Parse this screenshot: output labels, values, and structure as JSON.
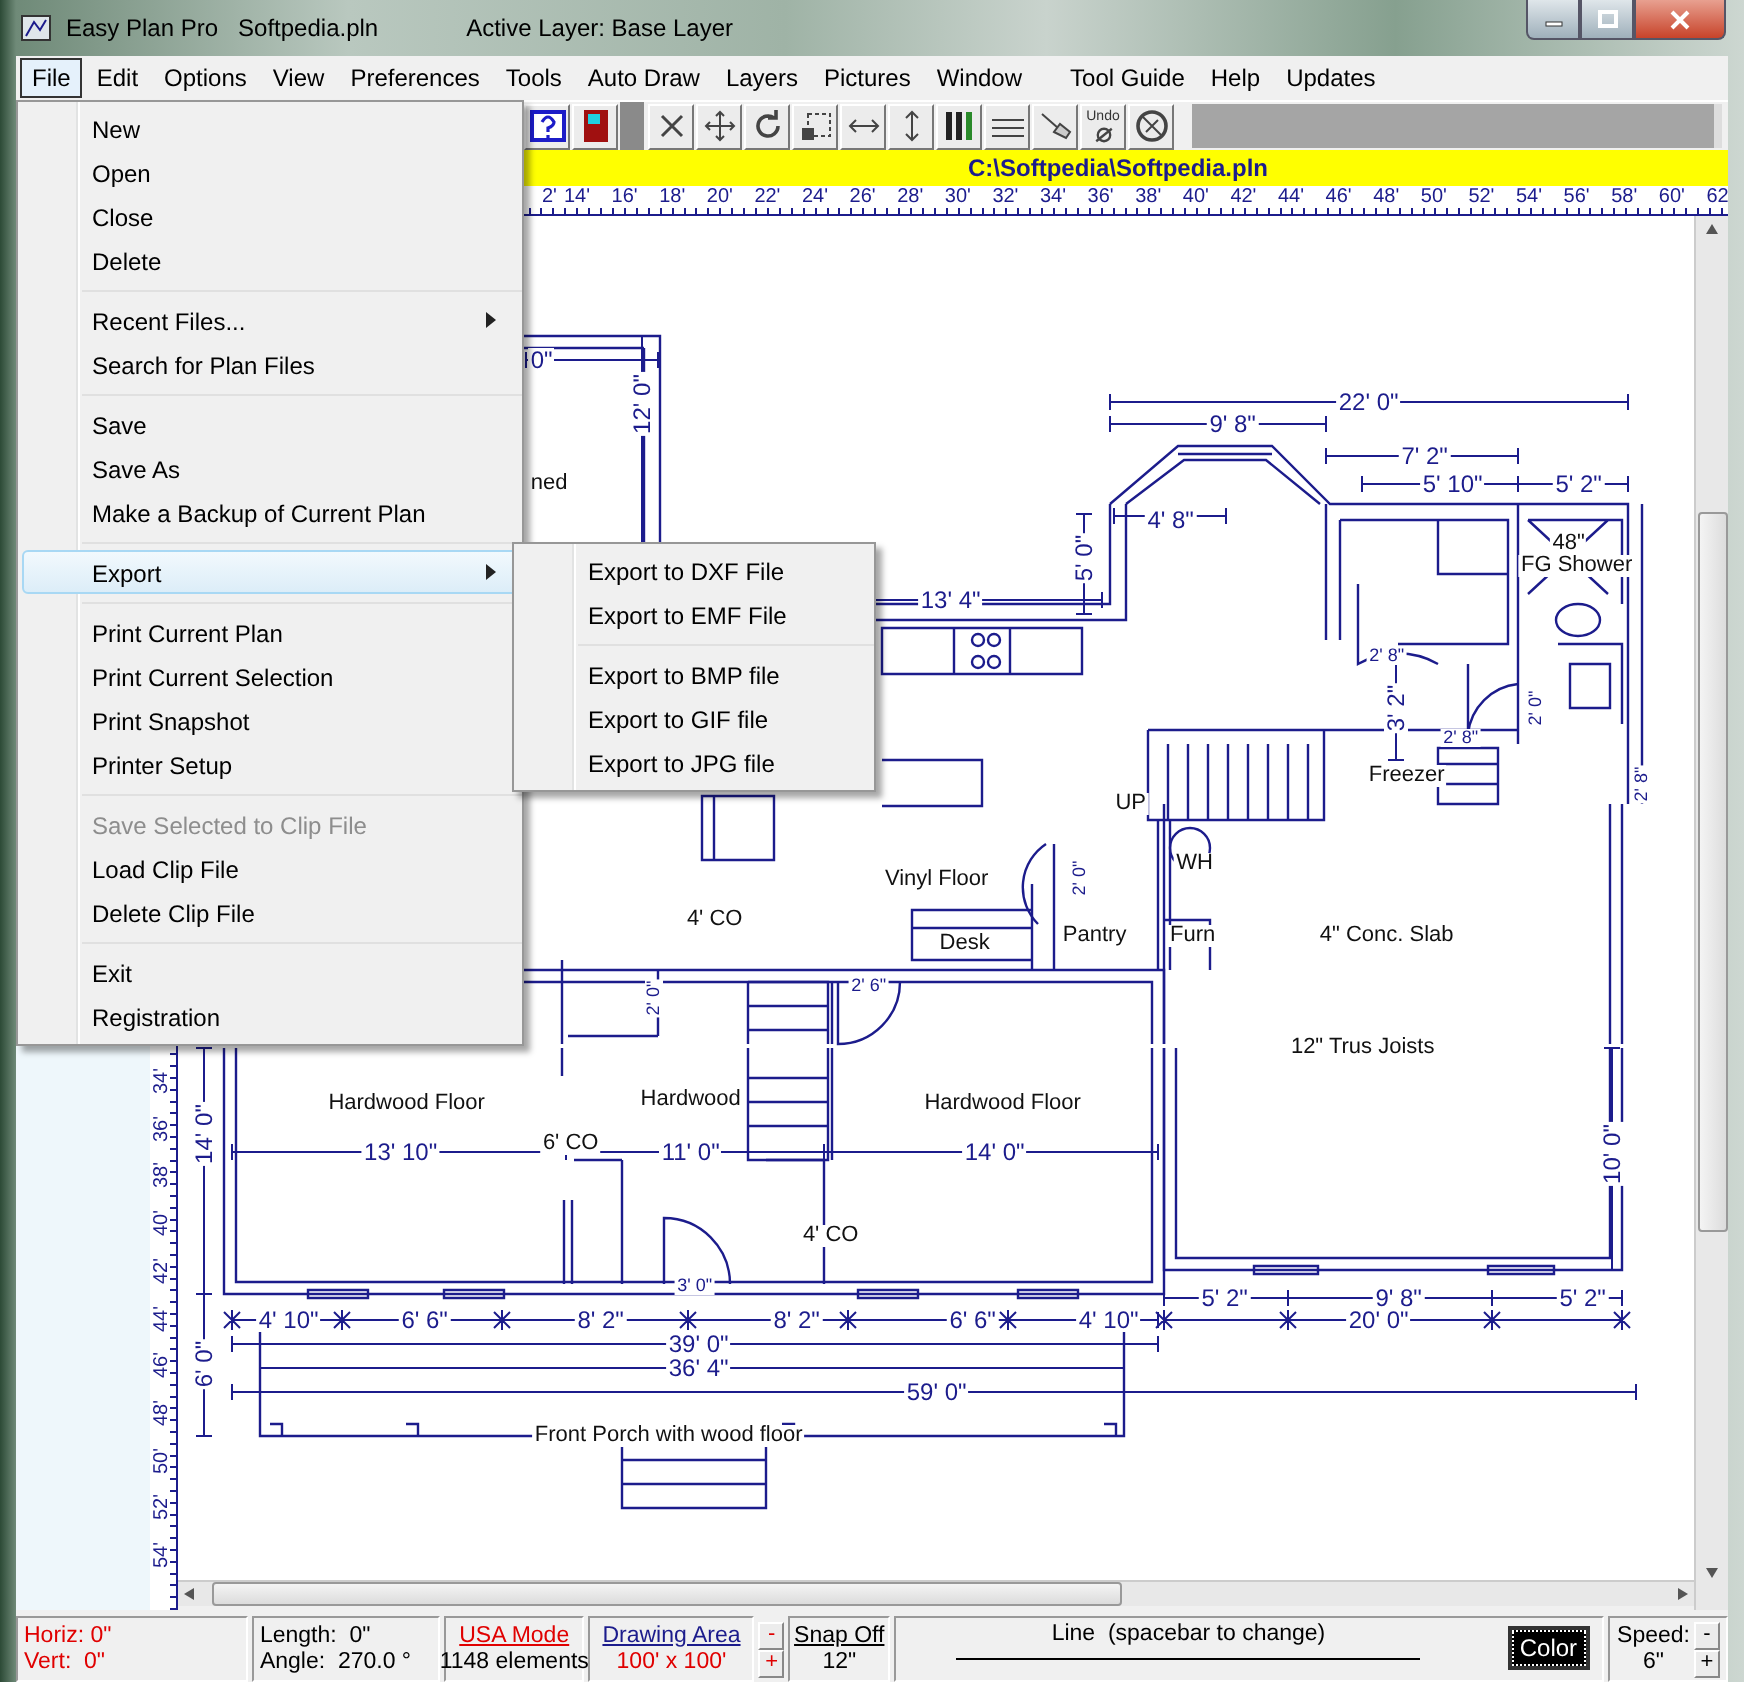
{
  "window": {
    "title": "Easy Plan Pro   Softpedia.pln",
    "active_layer": "Active Layer: Base Layer"
  },
  "menu_bar": [
    {
      "label": "File",
      "selected": true
    },
    {
      "label": "Edit",
      "selected": false
    },
    {
      "label": "Options",
      "selected": false
    },
    {
      "label": "View",
      "selected": false
    },
    {
      "label": "Preferences",
      "selected": false
    },
    {
      "label": "Tools",
      "selected": false
    },
    {
      "label": "Auto Draw",
      "selected": false
    },
    {
      "label": "Layers",
      "selected": false
    },
    {
      "label": "Pictures",
      "selected": false
    },
    {
      "label": "Window",
      "selected": false
    },
    {
      "label": "Tool Guide",
      "selected": false
    },
    {
      "label": "Help",
      "selected": false
    },
    {
      "label": "Updates",
      "selected": false
    }
  ],
  "toolbar": {
    "undo_label": "Undo"
  },
  "file_menu": {
    "groups": [
      [
        {
          "label": "New",
          "selected": false,
          "disabled": false,
          "submenu": false
        },
        {
          "label": "Open",
          "selected": false,
          "disabled": false,
          "submenu": false
        },
        {
          "label": "Close",
          "selected": false,
          "disabled": false,
          "submenu": false
        },
        {
          "label": "Delete",
          "selected": false,
          "disabled": false,
          "submenu": false
        }
      ],
      [
        {
          "label": "Recent Files...",
          "selected": false,
          "disabled": false,
          "submenu": true
        },
        {
          "label": "Search for Plan Files",
          "selected": false,
          "disabled": false,
          "submenu": false
        }
      ],
      [
        {
          "label": "Save",
          "selected": false,
          "disabled": false,
          "submenu": false
        },
        {
          "label": "Save As",
          "selected": false,
          "disabled": false,
          "submenu": false
        },
        {
          "label": "Make a Backup of Current Plan",
          "selected": false,
          "disabled": false,
          "submenu": false
        }
      ],
      [
        {
          "label": "Export",
          "selected": true,
          "disabled": false,
          "submenu": true
        }
      ],
      [
        {
          "label": "Print Current Plan",
          "selected": false,
          "disabled": false,
          "submenu": false
        },
        {
          "label": "Print Current Selection",
          "selected": false,
          "disabled": false,
          "submenu": false
        },
        {
          "label": "Print Snapshot",
          "selected": false,
          "disabled": false,
          "submenu": false
        },
        {
          "label": "Printer Setup",
          "selected": false,
          "disabled": false,
          "submenu": false
        }
      ],
      [
        {
          "label": "Save Selected to Clip File",
          "selected": false,
          "disabled": true,
          "submenu": false
        },
        {
          "label": "Load Clip File",
          "selected": false,
          "disabled": false,
          "submenu": false
        },
        {
          "label": "Delete Clip File",
          "selected": false,
          "disabled": false,
          "submenu": false
        }
      ],
      [
        {
          "label": "Exit",
          "selected": false,
          "disabled": false,
          "submenu": false
        },
        {
          "label": "Registration",
          "selected": false,
          "disabled": false,
          "submenu": false
        }
      ]
    ]
  },
  "export_submenu": {
    "groups": [
      [
        "Export to DXF File",
        "Export to EMF File"
      ],
      [
        "Export to BMP file",
        "Export to GIF file",
        "Export to JPG file"
      ]
    ]
  },
  "path_bar": "C:\\Softpedia\\Softpedia.pln",
  "top_ruler": [
    "2'",
    "14'",
    "16'",
    "18'",
    "20'",
    "22'",
    "24'",
    "26'",
    "28'",
    "30'",
    "32'",
    "34'",
    "36'",
    "38'",
    "40'",
    "42'",
    "44'",
    "46'",
    "48'",
    "50'",
    "52'",
    "54'",
    "56'",
    "58'",
    "60'",
    "62"
  ],
  "left_ruler": [
    "34'",
    "36'",
    "38'",
    "40'",
    "42'",
    "44'",
    "46'",
    "48'",
    "50'",
    "52'",
    "54'"
  ],
  "plan_labels": [
    {
      "text": "0\"",
      "kind": "dimension"
    },
    {
      "text": "12' 0\"",
      "kind": "dimension"
    },
    {
      "text": "ned",
      "kind": "room"
    },
    {
      "text": "22' 0\"",
      "kind": "dimension"
    },
    {
      "text": "9' 8\"",
      "kind": "dimension"
    },
    {
      "text": "7' 2\"",
      "kind": "dimension"
    },
    {
      "text": "5' 10\"",
      "kind": "dimension"
    },
    {
      "text": "5' 2\"",
      "kind": "dimension"
    },
    {
      "text": "4' 8\"",
      "kind": "dimension"
    },
    {
      "text": "5' 0\"",
      "kind": "dimension"
    },
    {
      "text": "48\"",
      "kind": "room"
    },
    {
      "text": "FG Shower",
      "kind": "room"
    },
    {
      "text": "13' 4\"",
      "kind": "dimension"
    },
    {
      "text": "2' 8\"",
      "kind": "small"
    },
    {
      "text": "3' 2\"",
      "kind": "dimension"
    },
    {
      "text": "2' 0\"",
      "kind": "small"
    },
    {
      "text": "2' 8\"",
      "kind": "small"
    },
    {
      "text": "Freezer",
      "kind": "room"
    },
    {
      "text": "2' 8\"",
      "kind": "small"
    },
    {
      "text": "UP",
      "kind": "room"
    },
    {
      "text": "WH",
      "kind": "room"
    },
    {
      "text": "Vinyl Floor",
      "kind": "room"
    },
    {
      "text": "2' 0\"",
      "kind": "small"
    },
    {
      "text": "4' CO",
      "kind": "room"
    },
    {
      "text": "Desk",
      "kind": "room"
    },
    {
      "text": "Pantry",
      "kind": "room"
    },
    {
      "text": "Furn",
      "kind": "room"
    },
    {
      "text": "4\" Conc. Slab",
      "kind": "room"
    },
    {
      "text": "2' 6\"",
      "kind": "small"
    },
    {
      "text": "2' 0\"",
      "kind": "small"
    },
    {
      "text": "12\" Trus Joists",
      "kind": "room"
    },
    {
      "text": "Hardwood Floor",
      "kind": "room"
    },
    {
      "text": "Hardwood",
      "kind": "room"
    },
    {
      "text": "Hardwood Floor",
      "kind": "room"
    },
    {
      "text": "13' 10\"",
      "kind": "dimension"
    },
    {
      "text": "6' CO",
      "kind": "room"
    },
    {
      "text": "11' 0\"",
      "kind": "dimension"
    },
    {
      "text": "14' 0\"",
      "kind": "dimension"
    },
    {
      "text": "10' 0\"",
      "kind": "dimension"
    },
    {
      "text": "14' 0\"",
      "kind": "dimension"
    },
    {
      "text": "4' CO",
      "kind": "room"
    },
    {
      "text": "3' 0\"",
      "kind": "small"
    },
    {
      "text": "5' 2\"",
      "kind": "dimension"
    },
    {
      "text": "9' 8\"",
      "kind": "dimension"
    },
    {
      "text": "5' 2\"",
      "kind": "dimension"
    },
    {
      "text": "4' 10\"",
      "kind": "dimension"
    },
    {
      "text": "6' 6\"",
      "kind": "dimension"
    },
    {
      "text": "8' 2\"",
      "kind": "dimension"
    },
    {
      "text": "8' 2\"",
      "kind": "dimension"
    },
    {
      "text": "6' 6\"",
      "kind": "dimension"
    },
    {
      "text": "4' 10\"",
      "kind": "dimension"
    },
    {
      "text": "20' 0\"",
      "kind": "dimension"
    },
    {
      "text": "39' 0\"",
      "kind": "dimension"
    },
    {
      "text": "36' 4\"",
      "kind": "dimension"
    },
    {
      "text": "6' 0\"",
      "kind": "dimension"
    },
    {
      "text": "59' 0\"",
      "kind": "dimension"
    },
    {
      "text": "Front Porch with wood floor",
      "kind": "room"
    }
  ],
  "status_bar": {
    "horiz": "Horiz: 0\"",
    "vert": "Vert:  0\"",
    "length": "Length:  0\"",
    "angle": "Angle:  270.0 °",
    "mode_link": "USA Mode",
    "elements": "1148 elements",
    "area_link": "Drawing Area",
    "area": "100' x 100'",
    "area_minus": "-",
    "area_plus": "+",
    "snap_link": "Snap Off",
    "snap": "12\"",
    "line_mode": "Line  (spacebar to change)",
    "color_button": "Color",
    "speed_label": "Speed:",
    "speed": "6\"",
    "speed_minus": "-",
    "speed_plus": "+"
  }
}
